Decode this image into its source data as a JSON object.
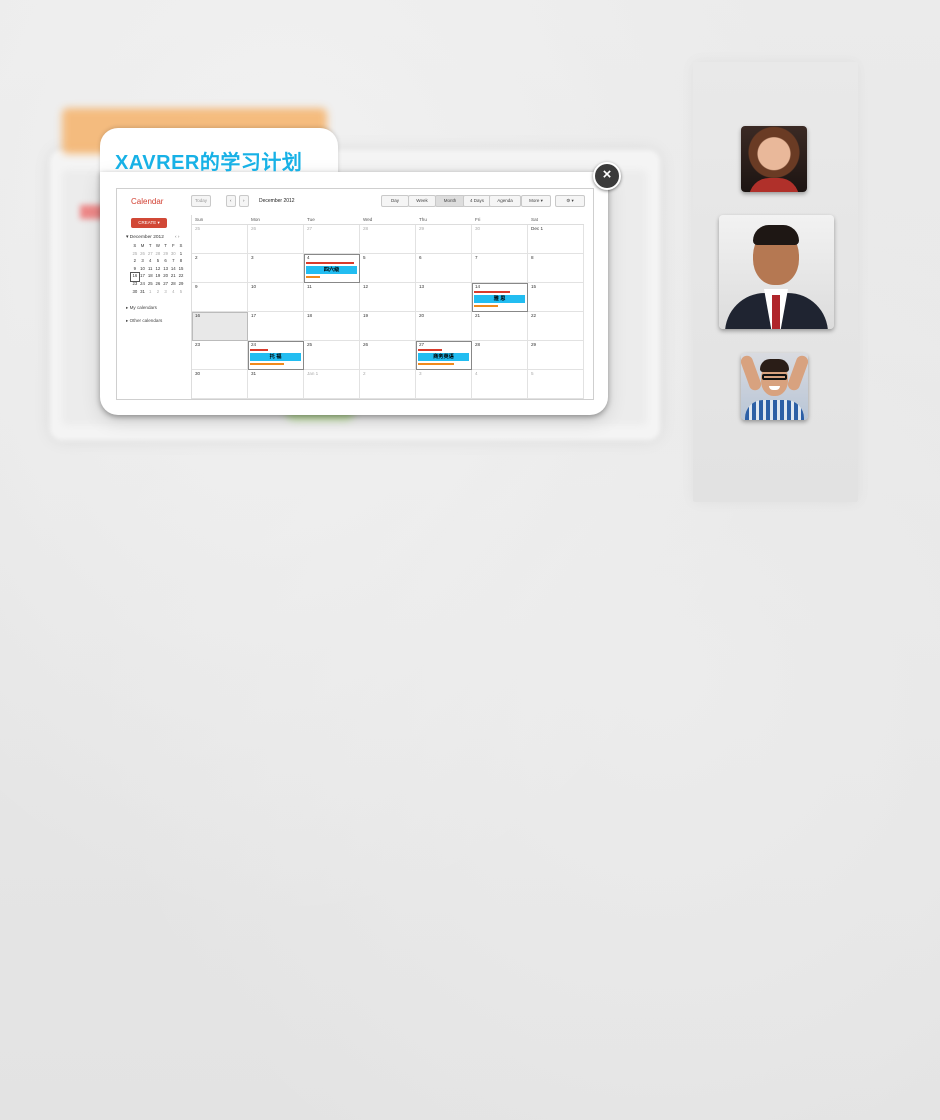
{
  "popup": {
    "title": "XAVRER的学习计划",
    "close_label": "×"
  },
  "calendar": {
    "app_name": "Calendar",
    "today_button": "Today",
    "prev_icon": "‹",
    "next_icon": "›",
    "current_month": "December 2012",
    "views": [
      "Day",
      "Week",
      "Month",
      "4 Days",
      "Agenda"
    ],
    "active_view": "Month",
    "more_button": "More ▾",
    "settings_icon": "⚙ ▾",
    "create_button": "CREATE ▾",
    "mini_month_title": "▾ December 2012",
    "mini_nav": "‹ ›",
    "mini_weekdays": [
      "S",
      "M",
      "T",
      "W",
      "T",
      "F",
      "S"
    ],
    "mini_days": [
      "25",
      "26",
      "27",
      "28",
      "29",
      "30",
      "1",
      "2",
      "3",
      "4",
      "5",
      "6",
      "7",
      "8",
      "9",
      "10",
      "11",
      "12",
      "13",
      "14",
      "15",
      "16",
      "17",
      "18",
      "19",
      "20",
      "21",
      "22",
      "23",
      "24",
      "25",
      "26",
      "27",
      "28",
      "29",
      "30",
      "31",
      "1",
      "2",
      "3",
      "4",
      "5"
    ],
    "my_calendars": "▸ My calendars",
    "other_calendars": "▸ Other calendars",
    "weekday_headers": [
      "Sun",
      "Mon",
      "Tue",
      "Wed",
      "Thu",
      "Fri",
      "Sat"
    ],
    "weeks": [
      [
        "25",
        "26",
        "27",
        "28",
        "29",
        "30",
        "Dec 1"
      ],
      [
        "2",
        "3",
        "4",
        "5",
        "6",
        "7",
        "8"
      ],
      [
        "9",
        "10",
        "11",
        "12",
        "13",
        "14",
        "15"
      ],
      [
        "16",
        "17",
        "18",
        "19",
        "20",
        "21",
        "22"
      ],
      [
        "23",
        "24",
        "25",
        "26",
        "27",
        "28",
        "29"
      ],
      [
        "30",
        "31",
        "Jan 1",
        "2",
        "3",
        "4",
        "5"
      ]
    ],
    "events": {
      "dec4": "四六级",
      "dec14": "雅 思",
      "dec24": "托 福",
      "dec27": "商务英语"
    }
  },
  "profiles": {
    "avatars": [
      "avatar-woman",
      "avatar-man-suit",
      "avatar-man-glasses"
    ]
  },
  "colors": {
    "title_blue": "#17b1e6",
    "event_blue": "#22bdf1",
    "event_red": "#d93a2b",
    "event_orange": "#f08a1c",
    "calendar_red": "#d14836"
  }
}
